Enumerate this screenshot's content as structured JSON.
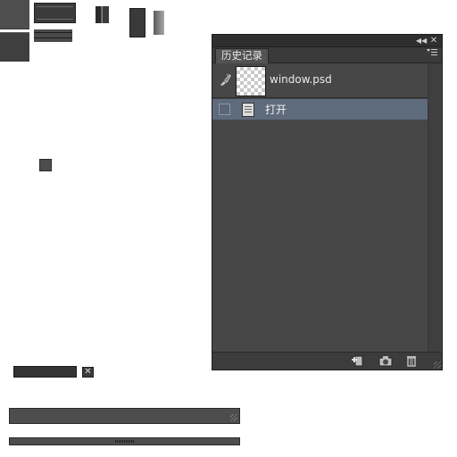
{
  "panel": {
    "tab_label": "历史记录",
    "collapse_icon": "double-chevron-left-icon",
    "close_label": "✕",
    "menu_icon": "panel-menu-icon"
  },
  "history": {
    "snapshot": {
      "label": "window.psd",
      "thumbnail": "transparent-checkerboard"
    },
    "states": [
      {
        "label": "打开",
        "icon": "document-icon",
        "selected": true
      }
    ]
  },
  "footer": {
    "buttons": [
      "create-new-document-from-state",
      "create-new-snapshot",
      "delete-state"
    ]
  },
  "sprites": {
    "close_glyph": "✕"
  },
  "colors": {
    "panel_bg": "#474747",
    "selected_row": "#5e6b7c",
    "titlebar": "#2f2f2f"
  }
}
